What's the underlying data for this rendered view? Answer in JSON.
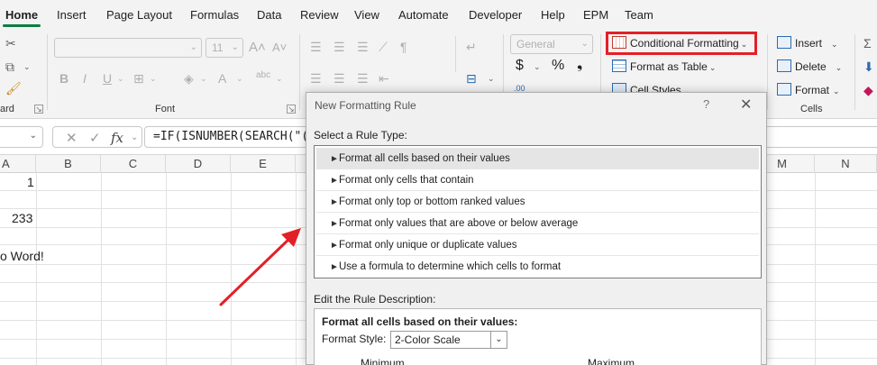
{
  "tabs": [
    "Home",
    "Insert",
    "Page Layout",
    "Formulas",
    "Data",
    "Review",
    "View",
    "Automate",
    "Developer",
    "Help",
    "EPM",
    "Team"
  ],
  "active_tab": "Home",
  "ribbon": {
    "clipboard_label": "ard",
    "font_label": "Font",
    "font_size": "11",
    "number_format": "General",
    "cells_label": "Cells",
    "conditional_formatting": "Conditional Formatting",
    "format_as_table": "Format as Table",
    "cell_styles": "Cell Styles",
    "insert": "Insert",
    "delete": "Delete",
    "format": "Format",
    "highlight_color": "#e32027"
  },
  "formula_bar": {
    "formula": "=IF(ISNUMBER(SEARCH(\"("
  },
  "grid": {
    "columns": [
      "A",
      "B",
      "C",
      "D",
      "E",
      "M",
      "N"
    ],
    "cells": {
      "a1": "1",
      "a3": "233",
      "a5": "o Word!"
    }
  },
  "dialog": {
    "title": "New Formatting Rule",
    "help": "?",
    "close": "✕",
    "select_rule_label": "Select a Rule Type:",
    "rule_types": [
      "Format all cells based on their values",
      "Format only cells that contain",
      "Format only top or bottom ranked values",
      "Format only values that are above or below average",
      "Format only unique or duplicate values",
      "Use a formula to determine which cells to format"
    ],
    "selected_rule_index": 0,
    "edit_rule_label": "Edit the Rule Description:",
    "description_title": "Format all cells based on their values:",
    "format_style_label": "Format Style:",
    "format_style_value": "2-Color Scale",
    "minimum_label": "Minimum",
    "maximum_label": "Maximum"
  },
  "annotation": {
    "arrow_color": "#e32027"
  }
}
